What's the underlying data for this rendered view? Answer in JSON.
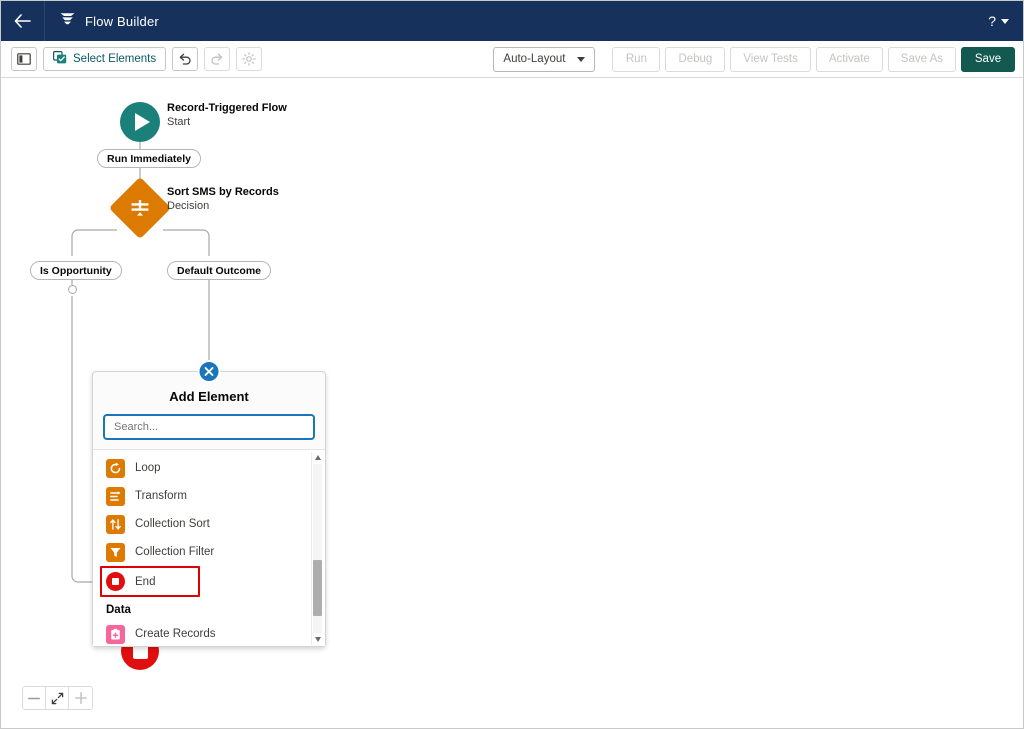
{
  "header": {
    "back_icon": "arrow-left-icon",
    "app_icon": "flow-builder-icon",
    "title": "Flow Builder",
    "help_label": "?"
  },
  "toolbar": {
    "toggle_panel_icon": "side-panel-toggle-icon",
    "select_elements_label": "Select Elements",
    "select_elements_icon": "select-elements-icon",
    "undo_icon": "undo-icon",
    "redo_icon": "redo-icon",
    "settings_icon": "gear-icon",
    "layout_mode": "Auto-Layout",
    "run_label": "Run",
    "debug_label": "Debug",
    "view_tests_label": "View Tests",
    "activate_label": "Activate",
    "save_as_label": "Save As",
    "save_label": "Save",
    "save_button_color": "#14594f"
  },
  "canvas": {
    "start": {
      "name": "Record-Triggered Flow",
      "type": "Start",
      "icon": "play-icon",
      "color": "#1b7f7a"
    },
    "schedule_pill": "Run Immediately",
    "decision": {
      "name": "Sort SMS by Records",
      "type": "Decision",
      "icon": "decision-icon",
      "color": "#dd7a01"
    },
    "branches": [
      {
        "label": "Is Opportunity"
      },
      {
        "label": "Default Outcome"
      }
    ],
    "end": {
      "name": "End",
      "icon": "end-stop-icon",
      "color": "#e00f0f"
    }
  },
  "popover": {
    "title": "Add Element",
    "close_icon": "close-icon",
    "search_placeholder": "Search...",
    "search_value": "",
    "items": [
      {
        "label": "Loop",
        "icon": "loop-icon",
        "color": "#dd7a01",
        "kind": "orange",
        "highlighted": false
      },
      {
        "label": "Transform",
        "icon": "transform-icon",
        "color": "#dd7a01",
        "kind": "orange",
        "highlighted": false
      },
      {
        "label": "Collection Sort",
        "icon": "collection-sort-icon",
        "color": "#dd7a01",
        "kind": "orange",
        "highlighted": false
      },
      {
        "label": "Collection Filter",
        "icon": "collection-filter-icon",
        "color": "#dd7a01",
        "kind": "orange",
        "highlighted": false
      },
      {
        "label": "End",
        "icon": "end-stop-icon",
        "color": "#e00f0f",
        "kind": "red",
        "highlighted": true
      }
    ],
    "section_label": "Data",
    "data_items": [
      {
        "label": "Create Records",
        "icon": "create-records-icon",
        "color": "#f5679b",
        "kind": "pink",
        "highlighted": false
      }
    ],
    "highlight_color": "#e00000",
    "scrollbar": {
      "up_icon": "scroll-up-arrow-icon",
      "down_icon": "scroll-down-arrow-icon"
    }
  },
  "zoom_controls": {
    "zoom_out_icon": "minus-icon",
    "fit_icon": "fit-to-view-icon",
    "zoom_in_icon": "plus-icon"
  }
}
